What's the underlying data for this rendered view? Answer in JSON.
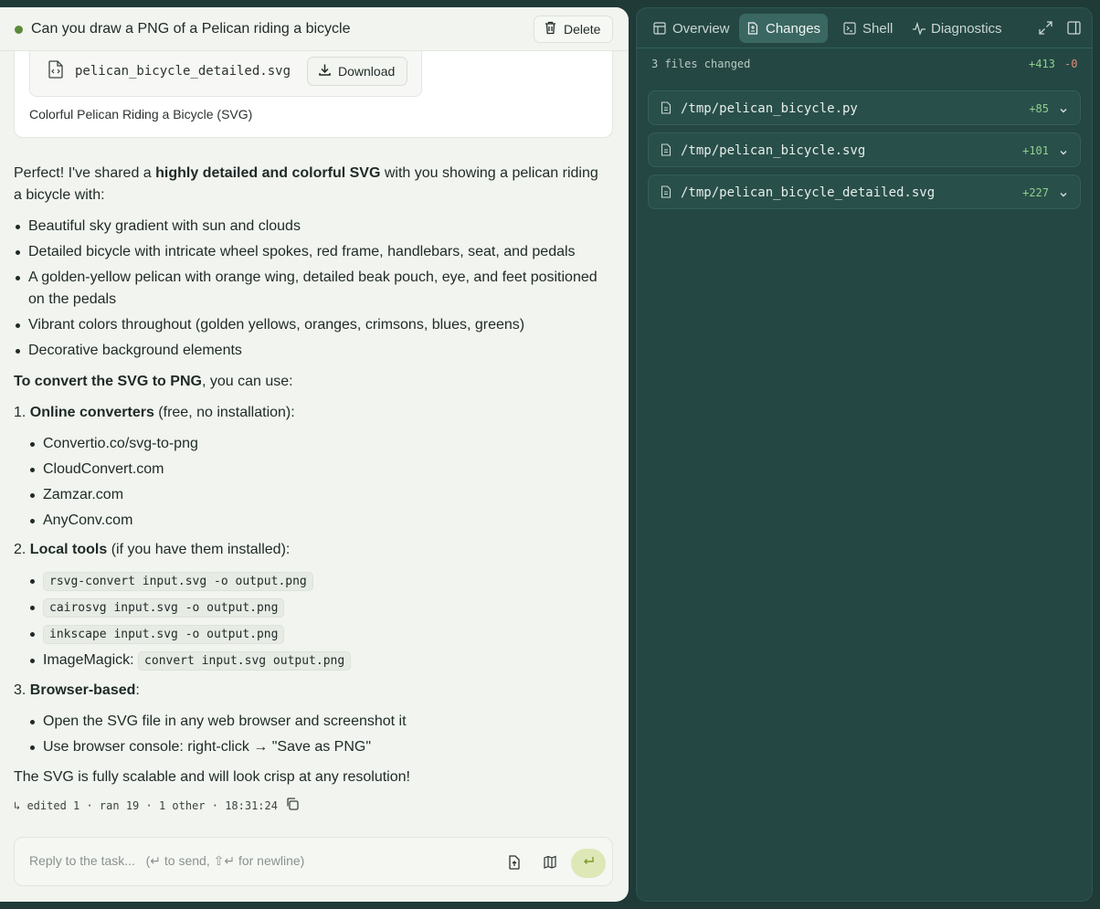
{
  "task": {
    "title": "Can you draw a PNG of a Pelican riding a bicycle",
    "delete_label": "Delete"
  },
  "attachment": {
    "filename": "pelican_bicycle_detailed.svg",
    "download_label": "Download",
    "caption": "Colorful Pelican Riding a Bicycle (SVG)"
  },
  "message": {
    "intro_pre": "Perfect! I've shared a ",
    "intro_bold": "highly detailed and colorful SVG",
    "intro_post": " with you showing a pelican riding a bicycle with:",
    "features": [
      "Beautiful sky gradient with sun and clouds",
      "Detailed bicycle with intricate wheel spokes, red frame, handlebars, seat, and pedals",
      "A golden-yellow pelican with orange wing, detailed beak pouch, eye, and feet positioned on the pedals",
      "Vibrant colors throughout (golden yellows, oranges, crimsons, blues, greens)",
      "Decorative background elements"
    ],
    "convert_bold": "To convert the SVG to PNG",
    "convert_post": ", you can use:",
    "online_num": "1.",
    "online_bold": "Online converters",
    "online_post": " (free, no installation):",
    "online_items": [
      "Convertio.co/svg-to-png",
      "CloudConvert.com",
      "Zamzar.com",
      "AnyConv.com"
    ],
    "local_num": "2.",
    "local_bold": "Local tools",
    "local_post": " (if you have them installed):",
    "local_items": [
      "rsvg-convert input.svg -o output.png",
      "cairosvg input.svg -o output.png",
      "inkscape input.svg -o output.png"
    ],
    "imagemagick_label": "ImageMagick: ",
    "imagemagick_code": "convert input.svg output.png",
    "browser_num": "3.",
    "browser_bold": "Browser-based",
    "browser_post": ":",
    "browser_items": [
      "Open the SVG file in any web browser and screenshot it",
      "Use browser console: right-click → \"Save as PNG\""
    ],
    "closing": "The SVG is fully scalable and will look crisp at any resolution!",
    "meta": "↳ edited 1 · ran 19 · 1 other · 18:31:24"
  },
  "reply": {
    "placeholder": "Reply to the task...   (↵ to send, ⇧↵ for newline)"
  },
  "right_panel": {
    "tabs": [
      "Overview",
      "Changes",
      "Shell",
      "Diagnostics"
    ],
    "active_tab": "Changes",
    "summary": "3 files changed",
    "additions": "+413",
    "deletions": "-0",
    "files": [
      {
        "path": "/tmp/pelican_bicycle.py",
        "added": "+85"
      },
      {
        "path": "/tmp/pelican_bicycle.svg",
        "added": "+101"
      },
      {
        "path": "/tmp/pelican_bicycle_detailed.svg",
        "added": "+227"
      }
    ]
  },
  "colors": {
    "page_bg": "#1f3a37",
    "chat_bg": "#f1f4ef",
    "panel_bg": "#244743",
    "active_tab": "#3b6762",
    "added_green": "#8fd08d",
    "removed_red": "#e08a80",
    "send_button": "#dde8b6",
    "status_dot": "#5b8a3a"
  }
}
